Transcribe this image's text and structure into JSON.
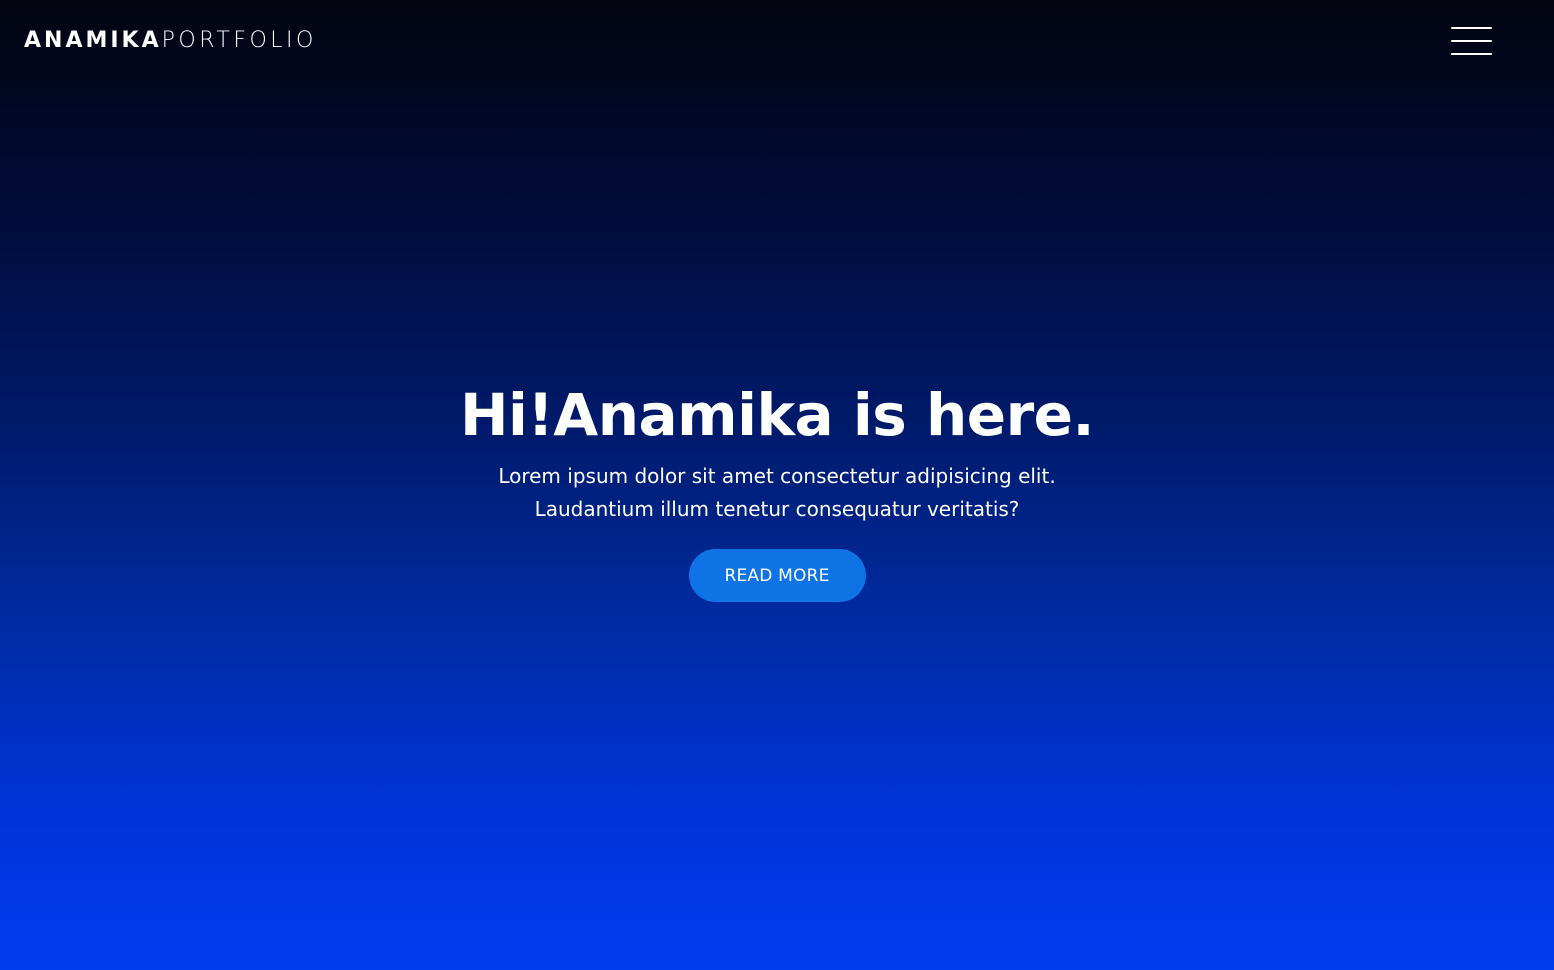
{
  "header": {
    "brand_primary": "ANAMIKA",
    "brand_secondary": "PORTFOLIO",
    "menu_icon": "hamburger-menu-icon"
  },
  "hero": {
    "title": "Hi!Anamika is here.",
    "text_line_1": "Lorem ipsum dolor sit amet consectetur adipisicing elit.",
    "text_line_2": "Laudantium illum tenetur consequatur veritatis?",
    "button_label": "READ MORE"
  },
  "colors": {
    "background_top": "#02040f",
    "background_bottom": "#003cf0",
    "button": "#0e74e6",
    "text": "#ffffff"
  }
}
